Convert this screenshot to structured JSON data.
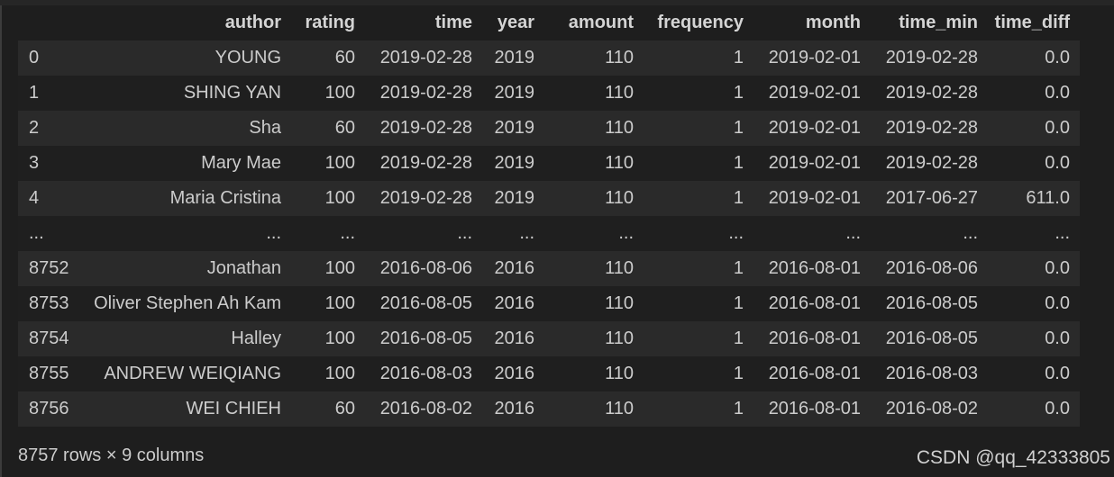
{
  "table": {
    "columns": [
      "author",
      "rating",
      "time",
      "year",
      "amount",
      "frequency",
      "month",
      "time_min",
      "time_diff"
    ],
    "rows": [
      {
        "index": "0",
        "cells": [
          "YOUNG",
          "60",
          "2019-02-28",
          "2019",
          "110",
          "1",
          "2019-02-01",
          "2019-02-28",
          "0.0"
        ]
      },
      {
        "index": "1",
        "cells": [
          "SHING YAN",
          "100",
          "2019-02-28",
          "2019",
          "110",
          "1",
          "2019-02-01",
          "2019-02-28",
          "0.0"
        ]
      },
      {
        "index": "2",
        "cells": [
          "Sha",
          "60",
          "2019-02-28",
          "2019",
          "110",
          "1",
          "2019-02-01",
          "2019-02-28",
          "0.0"
        ]
      },
      {
        "index": "3",
        "cells": [
          "Mary Mae",
          "100",
          "2019-02-28",
          "2019",
          "110",
          "1",
          "2019-02-01",
          "2019-02-28",
          "0.0"
        ]
      },
      {
        "index": "4",
        "cells": [
          "Maria Cristina",
          "100",
          "2019-02-28",
          "2019",
          "110",
          "1",
          "2019-02-01",
          "2017-06-27",
          "611.0"
        ]
      },
      {
        "index": "...",
        "cells": [
          "...",
          "...",
          "...",
          "...",
          "...",
          "...",
          "...",
          "...",
          "..."
        ]
      },
      {
        "index": "8752",
        "cells": [
          "Jonathan",
          "100",
          "2016-08-06",
          "2016",
          "110",
          "1",
          "2016-08-01",
          "2016-08-06",
          "0.0"
        ]
      },
      {
        "index": "8753",
        "cells": [
          "Oliver Stephen Ah Kam",
          "100",
          "2016-08-05",
          "2016",
          "110",
          "1",
          "2016-08-01",
          "2016-08-05",
          "0.0"
        ]
      },
      {
        "index": "8754",
        "cells": [
          "Halley",
          "100",
          "2016-08-05",
          "2016",
          "110",
          "1",
          "2016-08-01",
          "2016-08-05",
          "0.0"
        ]
      },
      {
        "index": "8755",
        "cells": [
          "ANDREW WEIQIANG",
          "100",
          "2016-08-03",
          "2016",
          "110",
          "1",
          "2016-08-01",
          "2016-08-03",
          "0.0"
        ]
      },
      {
        "index": "8756",
        "cells": [
          "WEI CHIEH",
          "60",
          "2016-08-02",
          "2016",
          "110",
          "1",
          "2016-08-01",
          "2016-08-02",
          "0.0"
        ]
      }
    ]
  },
  "footer": {
    "shape_text": "8757 rows × 9 columns"
  },
  "watermark": {
    "text": "CSDN @qq_42333805"
  }
}
